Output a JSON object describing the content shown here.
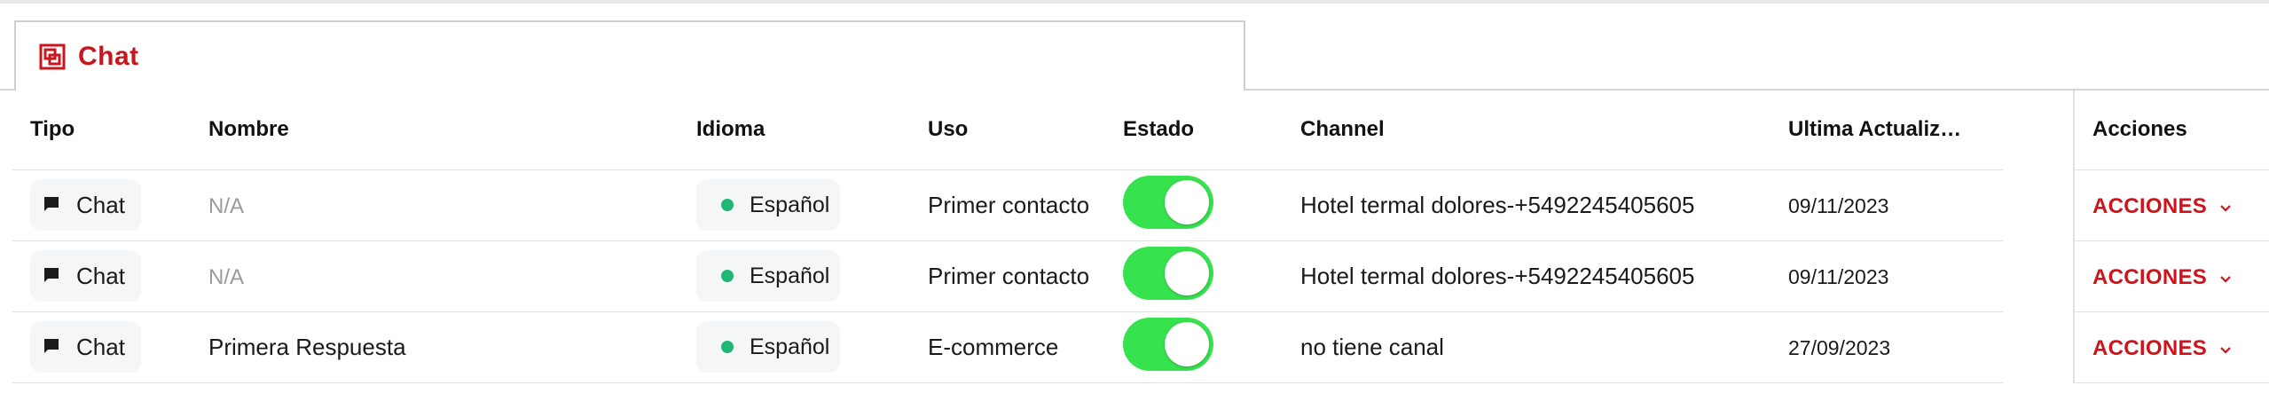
{
  "tab": {
    "label": "Chat",
    "icon": "chat-window-icon"
  },
  "colors": {
    "accent": "#c8161d",
    "toggle_on": "#37e24f",
    "status_dot": "#1fb872"
  },
  "table": {
    "headers": {
      "tipo": "Tipo",
      "nombre": "Nombre",
      "idioma": "Idioma",
      "uso": "Uso",
      "estado": "Estado",
      "channel": "Channel",
      "ultima": "Ultima Actualiz…",
      "acciones": "Acciones"
    },
    "rows": [
      {
        "tipo": "Chat",
        "nombre": "N/A",
        "idioma": "Español",
        "uso": "Primer contacto",
        "estado": true,
        "channel": "Hotel termal dolores-+5492245405605",
        "ultima": "09/11/2023",
        "acciones": "ACCIONES"
      },
      {
        "tipo": "Chat",
        "nombre": "N/A",
        "idioma": "Español",
        "uso": "Primer contacto",
        "estado": true,
        "channel": "Hotel termal dolores-+5492245405605",
        "ultima": "09/11/2023",
        "acciones": "ACCIONES"
      },
      {
        "tipo": "Chat",
        "nombre": "Primera Respuesta",
        "idioma": "Español",
        "uso": "E-commerce",
        "estado": true,
        "channel": "no tiene canal",
        "ultima": "27/09/2023",
        "acciones": "ACCIONES"
      }
    ]
  }
}
